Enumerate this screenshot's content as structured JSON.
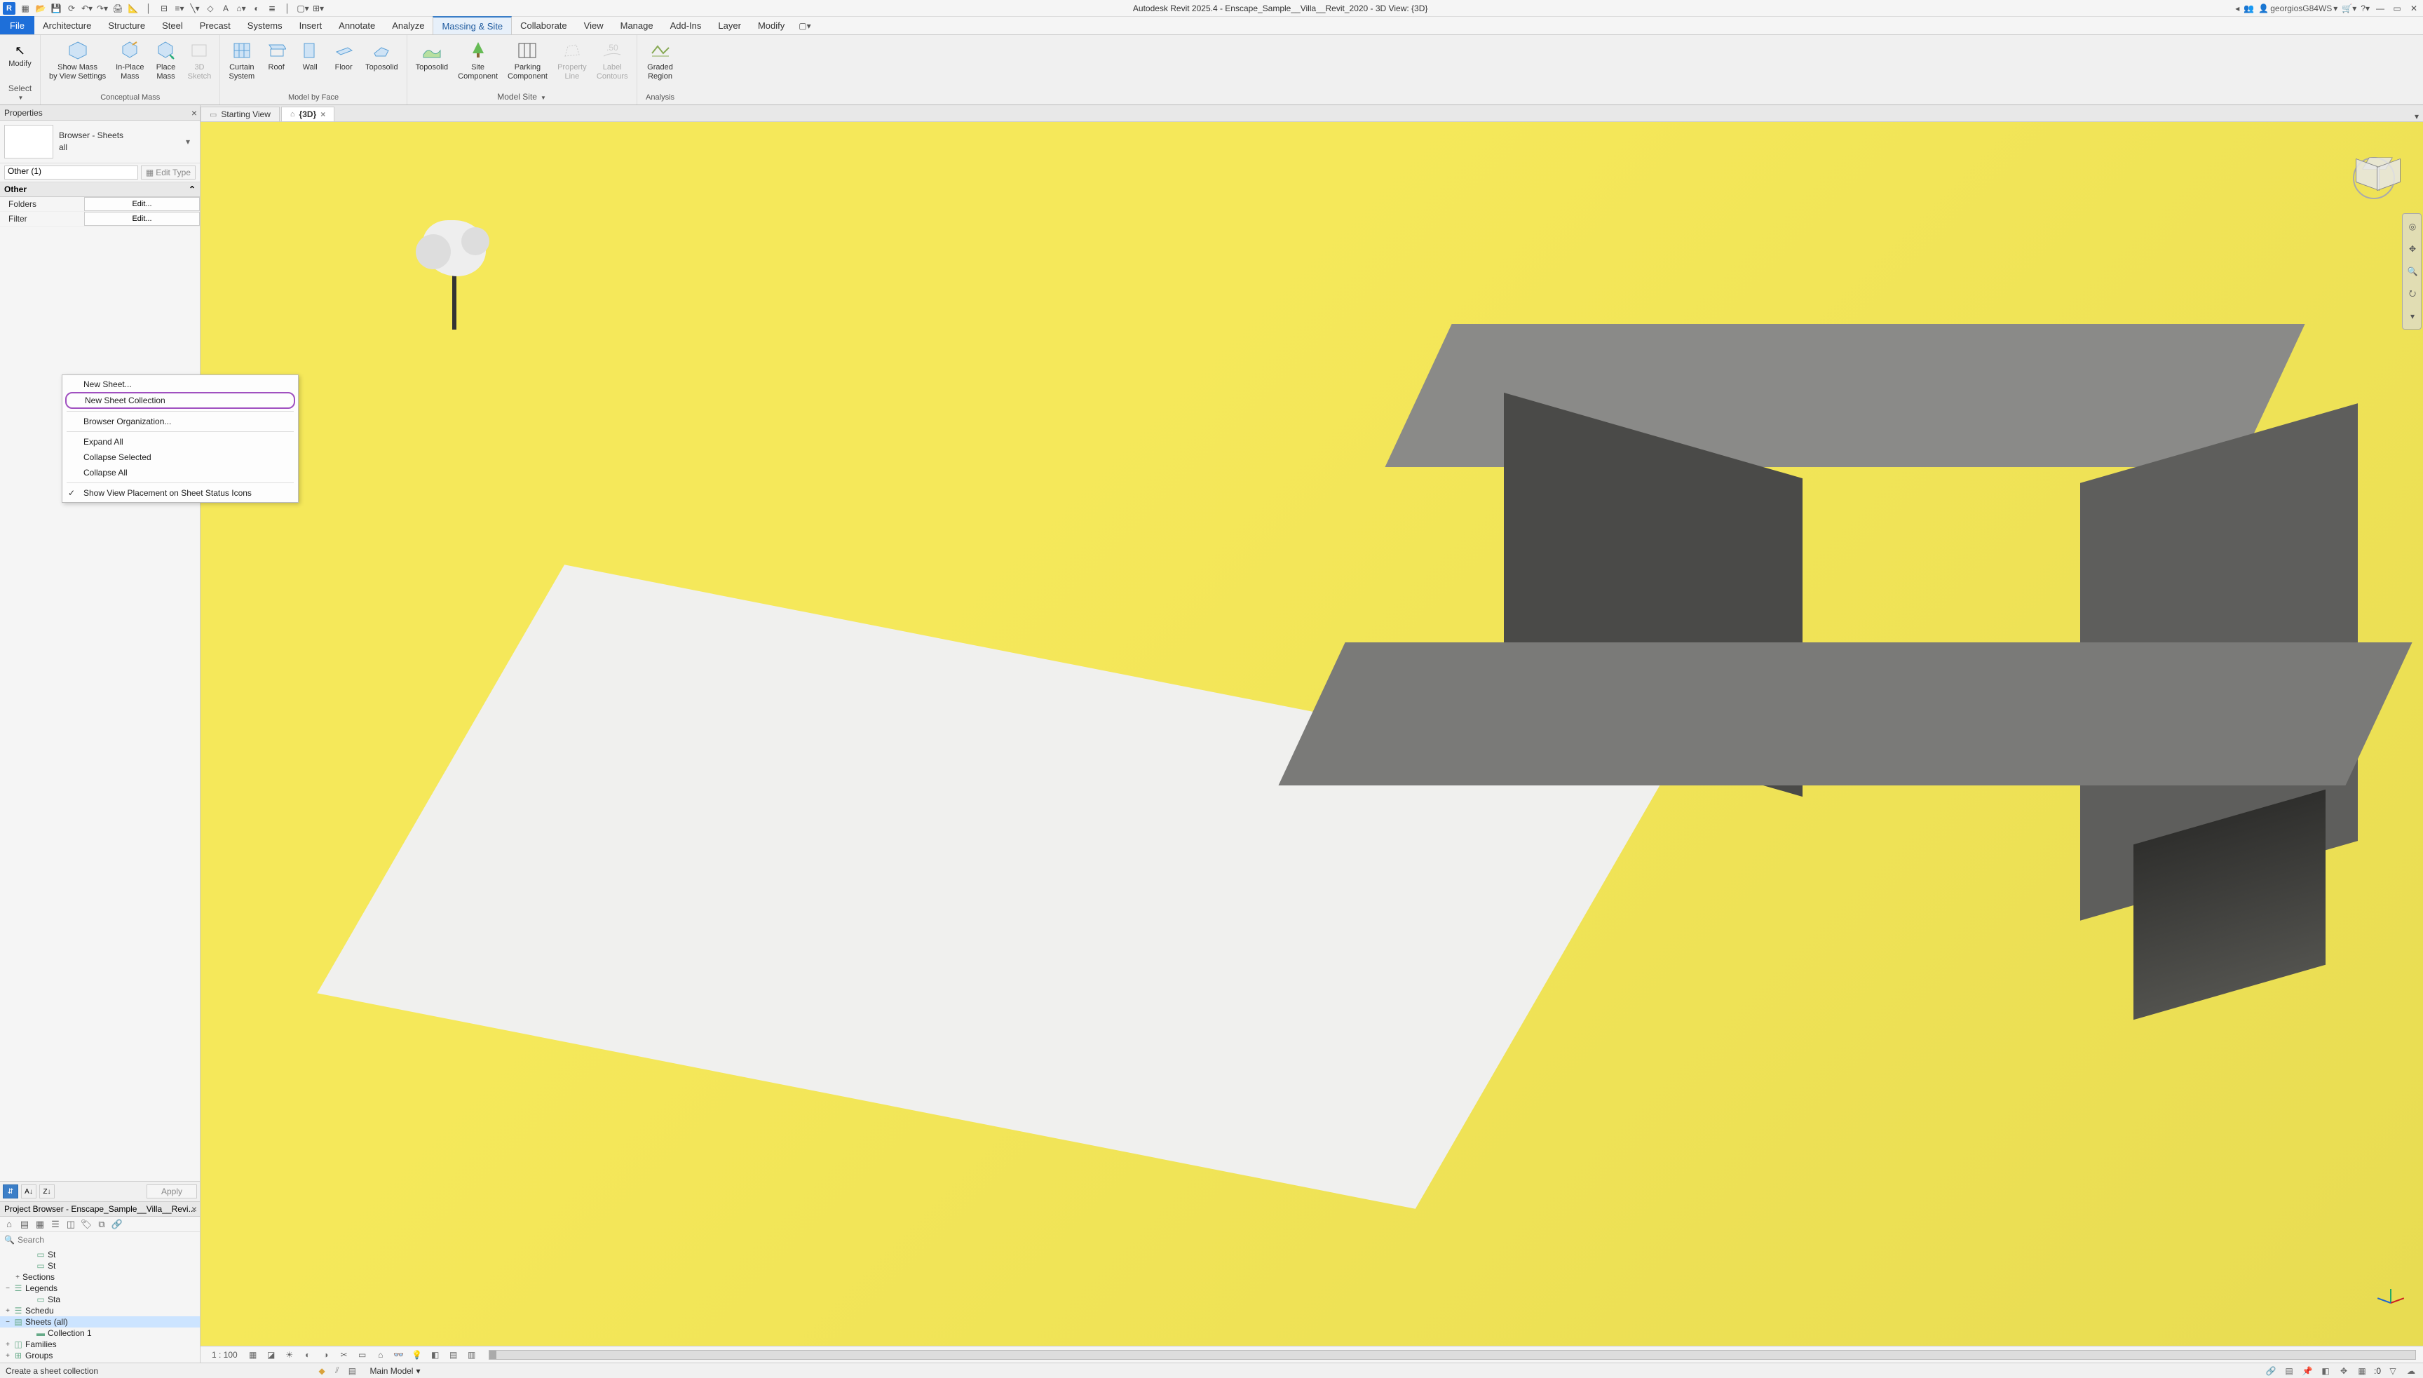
{
  "title_bar": {
    "app_initial": "R",
    "title": "Autodesk Revit 2025.4 - Enscape_Sample__Villa__Revit_2020 - 3D View: {3D}",
    "username": "georgiosG84WS",
    "help_symbol": "?"
  },
  "ribbon_tabs": {
    "file": "File",
    "tabs": [
      "Architecture",
      "Structure",
      "Steel",
      "Precast",
      "Systems",
      "Insert",
      "Annotate",
      "Analyze",
      "Massing & Site",
      "Collaborate",
      "View",
      "Manage",
      "Add-Ins",
      "Layer",
      "Modify"
    ],
    "active_index": 8
  },
  "ribbon": {
    "modify": {
      "label": "Modify",
      "select": "Select"
    },
    "conceptual_mass": {
      "label": "Conceptual Mass",
      "show_mass": "Show Mass\nby View Settings",
      "inplace": "In-Place\nMass",
      "place": "Place\nMass",
      "sketch": "3D\nSketch"
    },
    "model_by_face": {
      "label": "Model by Face",
      "curtain": "Curtain\nSystem",
      "roof": "Roof",
      "wall": "Wall",
      "floor": "Floor",
      "toposolid": "Toposolid"
    },
    "model_site": {
      "label": "Model Site",
      "toposolid": "Toposolid",
      "site_component": "Site\nComponent",
      "parking": "Parking\nComponent",
      "property_line": "Property\nLine",
      "label_contours": "Label\nContours"
    },
    "analysis": {
      "label": "Analysis",
      "graded": "Graded\nRegion"
    }
  },
  "properties": {
    "header": "Properties",
    "type_line1": "Browser - Sheets",
    "type_line2": "all",
    "filter": "Other (1)",
    "edit_type": "Edit Type",
    "cat": "Other",
    "folders_label": "Folders",
    "filter_label": "Filter",
    "edit_btn": "Edit...",
    "apply": "Apply"
  },
  "project_browser": {
    "header": "Project Browser - Enscape_Sample__Villa__Revi...",
    "search_placeholder": "Search",
    "nodes": {
      "sections": "Sections",
      "legends": "Legends",
      "starting": "Sta",
      "schedules": "Schedu",
      "sheets": "Sheets (all)",
      "collection1": "Collection 1",
      "families": "Families",
      "groups": "Groups"
    }
  },
  "context_menu": {
    "new_sheet": "New Sheet...",
    "new_collection": "New Sheet Collection",
    "browser_org": "Browser Organization...",
    "expand_all": "Expand All",
    "collapse_selected": "Collapse Selected",
    "collapse_all": "Collapse All",
    "show_placement": "Show View Placement on Sheet Status Icons"
  },
  "view_tabs": {
    "tab1": "Starting View",
    "tab2": "{3D}"
  },
  "view_ctrl": {
    "scale": "1 : 100"
  },
  "status_bar": {
    "hint": "Create a sheet collection",
    "main_model": "Main Model",
    "selection_count": ":0"
  }
}
